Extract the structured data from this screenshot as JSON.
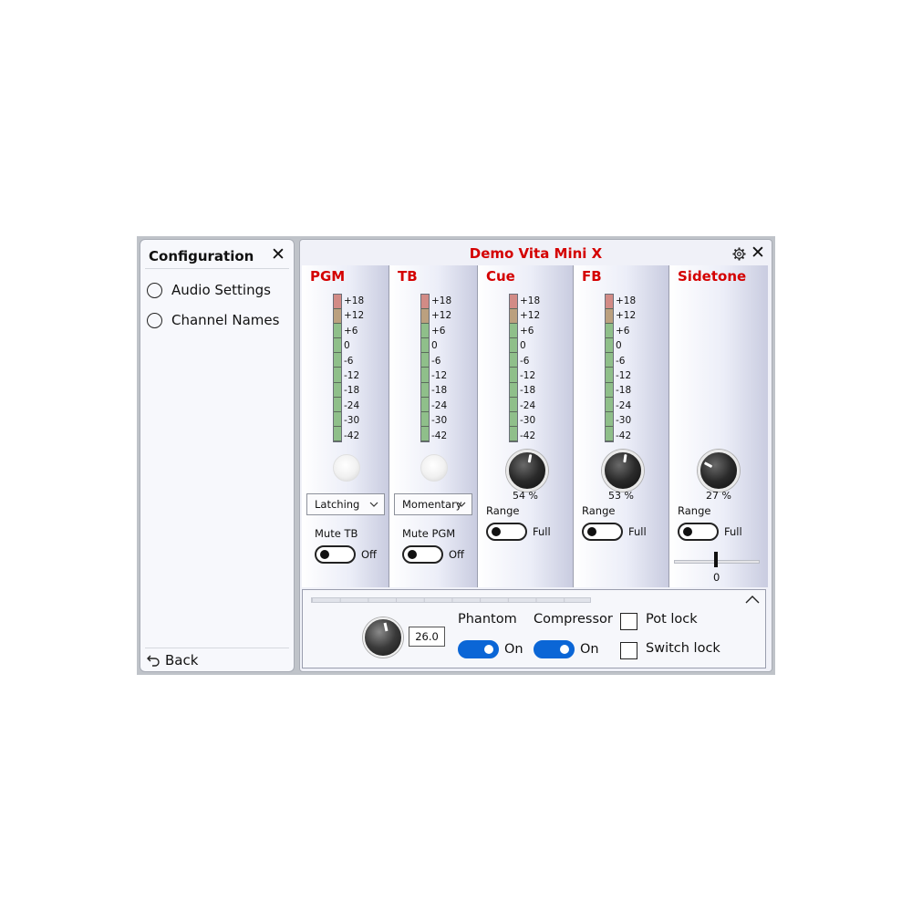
{
  "config": {
    "title": "Configuration",
    "close_label": "✕",
    "items": [
      {
        "label": "Audio Settings"
      },
      {
        "label": "Channel Names"
      }
    ],
    "back_label": "Back"
  },
  "device": {
    "title": "Demo Vita Mini X",
    "close_label": "✕",
    "title_color": "#d40000"
  },
  "meter_scale": [
    "+18",
    "+12",
    "+6",
    "0",
    "-6",
    "-12",
    "-18",
    "-24",
    "-30",
    "-42"
  ],
  "channels": {
    "pgm": {
      "name": "PGM",
      "mode": "Latching",
      "mute_label": "Mute TB",
      "mute_state": "Off"
    },
    "tb": {
      "name": "TB",
      "mode": "Momentary",
      "mute_label": "Mute PGM",
      "mute_state": "Off"
    },
    "cue": {
      "name": "Cue",
      "level": "54 %",
      "level_value": 54,
      "range_label": "Range",
      "range_state": "Full"
    },
    "fb": {
      "name": "FB",
      "level": "53 %",
      "level_value": 53,
      "range_label": "Range",
      "range_state": "Full"
    },
    "sidetone": {
      "name": "Sidetone",
      "level": "27 %",
      "level_value": 27,
      "range_label": "Range",
      "range_state": "Full",
      "balance": "0"
    }
  },
  "bottom": {
    "gain_value": "26.0",
    "phantom_label": "Phantom",
    "phantom_state": "On",
    "compressor_label": "Compressor",
    "compressor_state": "On",
    "pot_lock_label": "Pot lock",
    "switch_lock_label": "Switch lock"
  }
}
